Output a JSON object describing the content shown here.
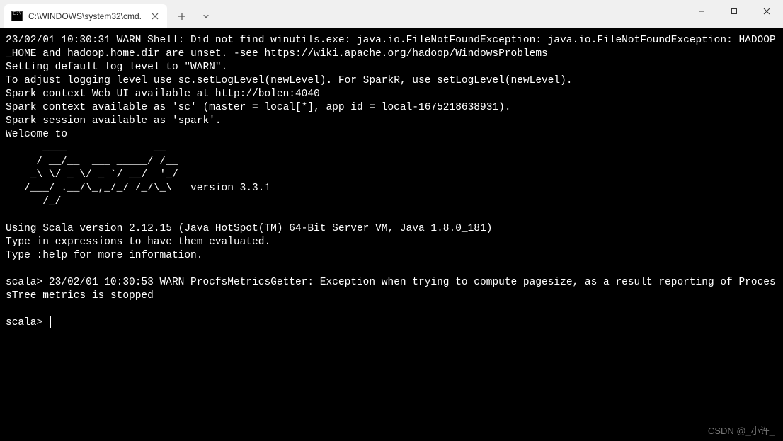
{
  "tab": {
    "title": "C:\\WINDOWS\\system32\\cmd."
  },
  "terminal": {
    "lines": "23/02/01 10:30:31 WARN Shell: Did not find winutils.exe: java.io.FileNotFoundException: java.io.FileNotFoundException: HADOOP_HOME and hadoop.home.dir are unset. -see https://wiki.apache.org/hadoop/WindowsProblems\nSetting default log level to \"WARN\".\nTo adjust logging level use sc.setLogLevel(newLevel). For SparkR, use setLogLevel(newLevel).\nSpark context Web UI available at http://bolen:4040\nSpark context available as 'sc' (master = local[*], app id = local-1675218638931).\nSpark session available as 'spark'.\nWelcome to\n      ____              __\n     / __/__  ___ _____/ /__\n    _\\ \\/ _ \\/ _ `/ __/  '_/\n   /___/ .__/\\_,_/_/ /_/\\_\\   version 3.3.1\n      /_/\n\nUsing Scala version 2.12.15 (Java HotSpot(TM) 64-Bit Server VM, Java 1.8.0_181)\nType in expressions to have them evaluated.\nType :help for more information.\n\nscala> 23/02/01 10:30:53 WARN ProcfsMetricsGetter: Exception when trying to compute pagesize, as a result reporting of ProcessTree metrics is stopped\n\n",
    "prompt": "scala> "
  },
  "watermark": "CSDN @_小许_"
}
